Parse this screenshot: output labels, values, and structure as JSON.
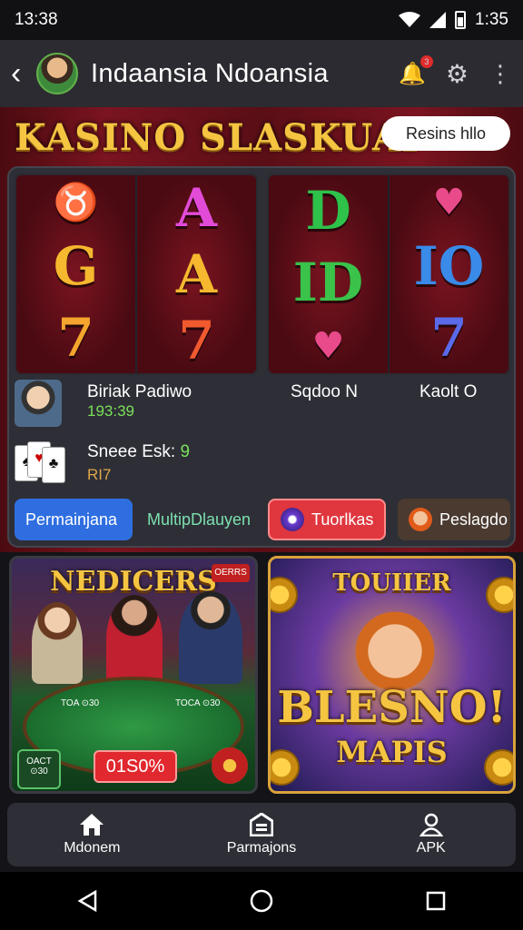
{
  "status": {
    "time_left": "13:38",
    "time_right": "1:35"
  },
  "appbar": {
    "title": "Indaansia Ndoansia",
    "notif_count": "3"
  },
  "hero": {
    "title": "KASINO SLASKUAI",
    "button": "Resins hllo",
    "reels_left": [
      [
        "♉",
        "G",
        "7"
      ],
      [
        "A",
        "A",
        "7"
      ]
    ],
    "reels_right": [
      [
        "D",
        "ID",
        "♥"
      ],
      [
        "♥",
        "IO",
        "7"
      ]
    ]
  },
  "players": [
    {
      "name": "Biriak Padiwo",
      "value": "193:39"
    },
    {
      "name": "Sneee Esk:",
      "suffix": "9",
      "value": "RI7"
    }
  ],
  "labels": {
    "mid": "Sqdoo N",
    "right": "Kaolt O"
  },
  "chips": [
    {
      "label": "Permainjana"
    },
    {
      "label": "MultipDlauyen"
    },
    {
      "label": "Tuorlkas"
    },
    {
      "label": "Peslagdo"
    }
  ],
  "promos": {
    "left": {
      "title": "NEDICERS",
      "corner": "OERRS",
      "badge": "OACT ⊙30",
      "felt_left": "TOA ⊙30",
      "felt_right": "TOCA ⊙30",
      "percent": "01S0%"
    },
    "right": {
      "kicker": "TOUIIER",
      "title": "BLESNO!",
      "subtitle": "MAPIS"
    }
  },
  "bottomnav": {
    "home": "Mdonem",
    "games": "Parmajons",
    "apk": "APK"
  },
  "colors": {
    "accent_gold": "#f5c542",
    "felt_red": "#7a1420",
    "chip_blue": "#2f6ee0",
    "chip_red": "#e0363e",
    "panel": "#2e2f36"
  },
  "icons": {
    "back": "chevron-left-icon",
    "bell": "bell-icon",
    "gear": "gear-icon",
    "more": "more-vertical-icon",
    "home": "home-icon",
    "games": "inbox-icon",
    "apk": "user-icon"
  }
}
